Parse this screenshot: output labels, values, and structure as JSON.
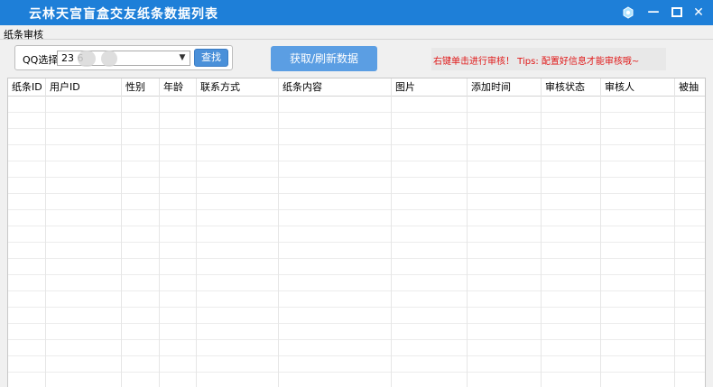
{
  "window": {
    "title": "云林天宫盲盒交友纸条数据列表",
    "buttons": {
      "skin": "skin-icon",
      "minimize": "—",
      "maximize": "☐",
      "close": "✕"
    }
  },
  "tabs": [
    {
      "label": "纸条审核"
    }
  ],
  "toolbar": {
    "qq_label": "QQ选择",
    "qq_value": "23       6",
    "find_label": "查找",
    "refresh_label": "获取/刷新数据",
    "tip": "右键单击进行审核！  Tips: 配置好信息才能审核哦~"
  },
  "table": {
    "columns": [
      "纸条ID",
      "用户ID",
      "性别",
      "年龄",
      "联系方式",
      "纸条内容",
      "图片",
      "添加时间",
      "审核状态",
      "审核人",
      "被抽"
    ],
    "rows": []
  }
}
